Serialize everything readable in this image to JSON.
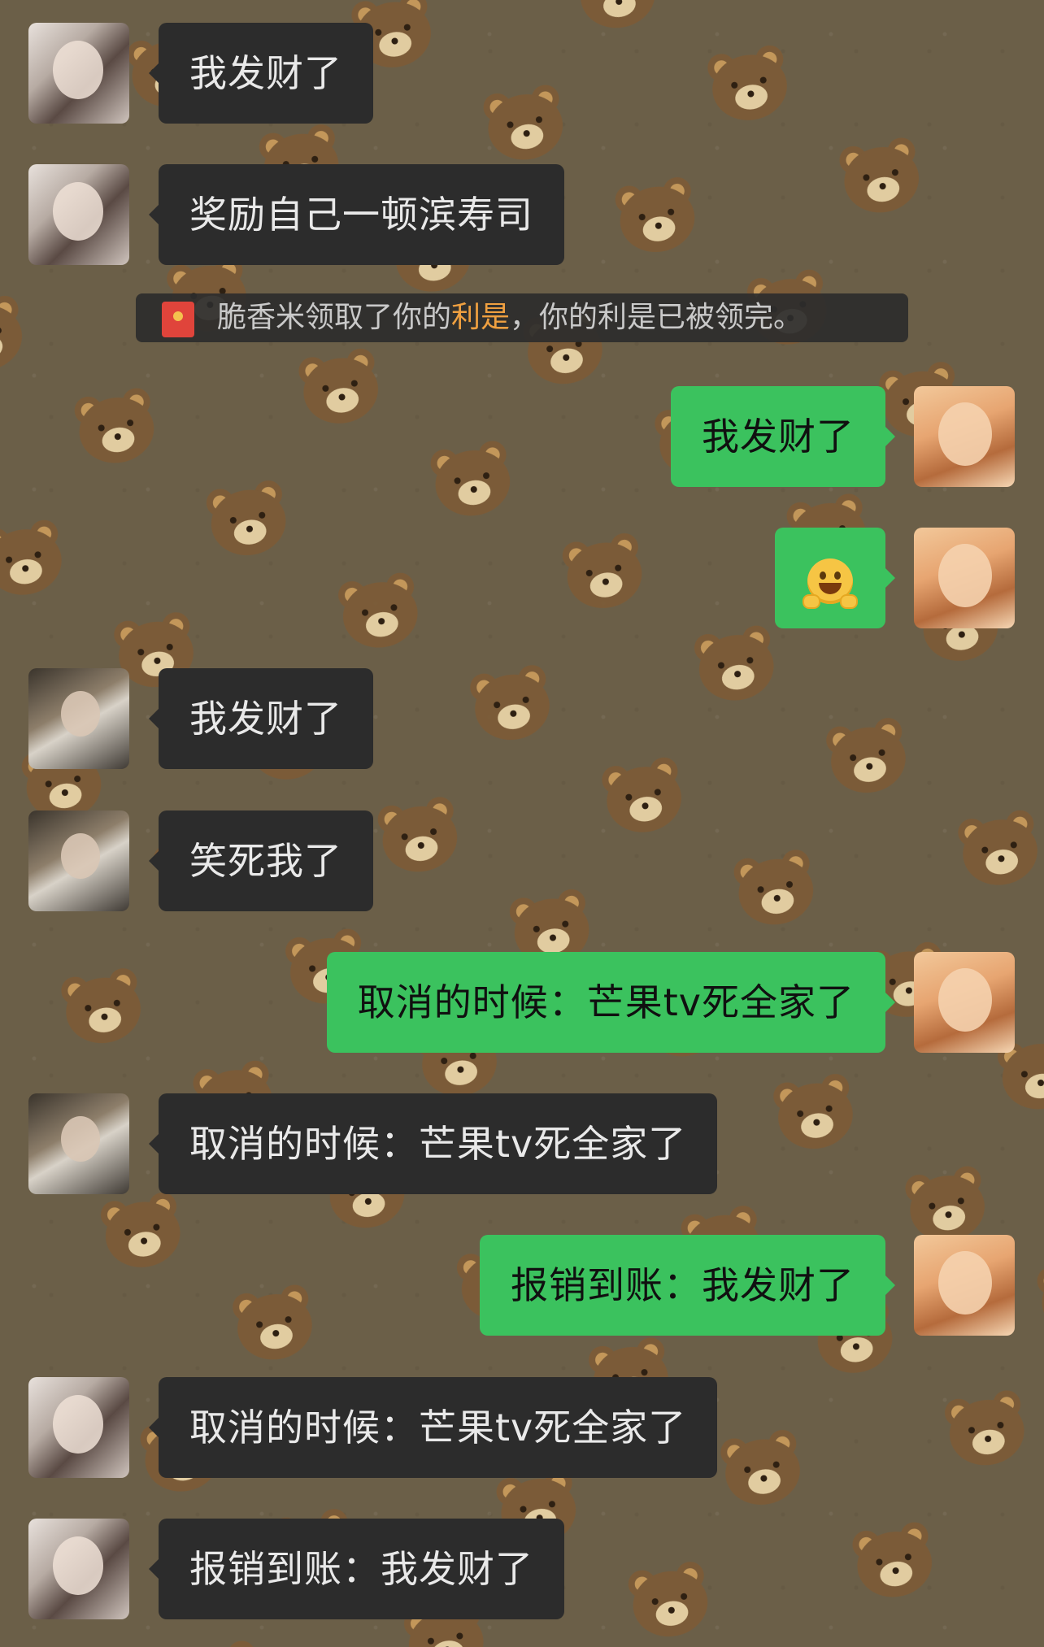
{
  "chat": {
    "messages": [
      {
        "side": "left",
        "avatar": "avatar-a",
        "text": "我发财了"
      },
      {
        "side": "left",
        "avatar": "avatar-a",
        "text": "奖励自己一顿滨寿司"
      },
      {
        "side": "right",
        "avatar": "avatar-c",
        "text": "我发财了"
      },
      {
        "side": "right",
        "avatar": "avatar-c",
        "text": "",
        "emoji": "hugging-face-icon"
      },
      {
        "side": "left",
        "avatar": "avatar-b",
        "text": "我发财了"
      },
      {
        "side": "left",
        "avatar": "avatar-b",
        "text": "笑死我了"
      },
      {
        "side": "right",
        "avatar": "avatar-c",
        "text": "取消的时候：芒果tv死全家了"
      },
      {
        "side": "left",
        "avatar": "avatar-b",
        "text": "取消的时候：芒果tv死全家了"
      },
      {
        "side": "right",
        "avatar": "avatar-c",
        "text": "报销到账：我发财了"
      },
      {
        "side": "left",
        "avatar": "avatar-a",
        "text": "取消的时候：芒果tv死全家了"
      },
      {
        "side": "left",
        "avatar": "avatar-a",
        "text": "报销到账：我发财了"
      }
    ],
    "system_notice": {
      "icon": "red-packet-icon",
      "prefix": "脆香米领取了你的",
      "highlight": "利是",
      "suffix": "，你的利是已被领完。"
    }
  },
  "colors": {
    "background": "#6b5f48",
    "incoming_bubble": "#2c2c2c",
    "outgoing_bubble": "#3bc25e",
    "highlight": "#f0a040"
  }
}
